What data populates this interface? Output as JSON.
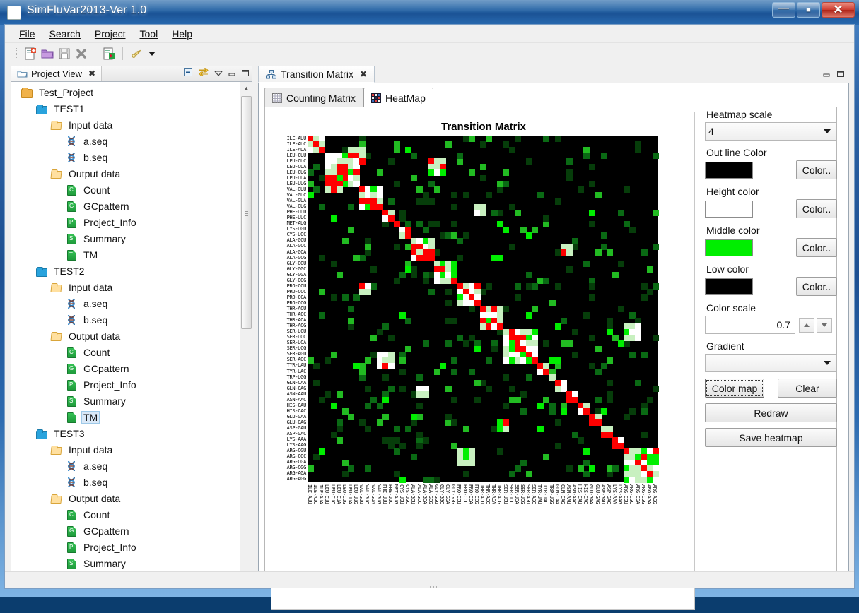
{
  "window": {
    "title": "SimFluVar2013-Ver 1.0",
    "app_icon": "app-icon",
    "buttons": {
      "minimize": "—",
      "maximize": "❐",
      "close": "✕"
    }
  },
  "menubar": {
    "items": [
      "File",
      "Search",
      "Project",
      "Tool",
      "Help"
    ]
  },
  "toolbar": {
    "icons": [
      "new-file-icon",
      "open-folder-icon",
      "save-icon",
      "delete-icon",
      "export-icon",
      "run-icon"
    ],
    "dropdown": "chevron-down-icon"
  },
  "project_view": {
    "tab_label": "Project View",
    "close": "✖",
    "tools": [
      "collapse-all-icon",
      "link-with-editor-icon",
      "view-menu-icon",
      "minimize-icon",
      "maximize-icon"
    ],
    "tree": [
      {
        "label": "Test_Project",
        "depth": 0,
        "icon": "project-folder-icon",
        "selected": false
      },
      {
        "label": "TEST1",
        "depth": 1,
        "icon": "blue-folder-icon",
        "selected": false
      },
      {
        "label": "Input data",
        "depth": 2,
        "icon": "open-folder-icon",
        "selected": false
      },
      {
        "label": "a.seq",
        "depth": 3,
        "icon": "dna-icon",
        "selected": false
      },
      {
        "label": "b.seq",
        "depth": 3,
        "icon": "dna-icon",
        "selected": false
      },
      {
        "label": "Output data",
        "depth": 2,
        "icon": "open-folder-icon",
        "selected": false
      },
      {
        "label": "Count",
        "depth": 3,
        "icon": "doc-c-icon",
        "selected": false,
        "ch": "C"
      },
      {
        "label": "GCpattern",
        "depth": 3,
        "icon": "doc-g-icon",
        "selected": false,
        "ch": "G"
      },
      {
        "label": "Project_Info",
        "depth": 3,
        "icon": "doc-p-icon",
        "selected": false,
        "ch": "P"
      },
      {
        "label": "Summary",
        "depth": 3,
        "icon": "doc-s-icon",
        "selected": false,
        "ch": "S"
      },
      {
        "label": "TM",
        "depth": 3,
        "icon": "doc-t-icon",
        "selected": false,
        "ch": "T"
      },
      {
        "label": "TEST2",
        "depth": 1,
        "icon": "blue-folder-icon",
        "selected": false
      },
      {
        "label": "Input data",
        "depth": 2,
        "icon": "open-folder-icon",
        "selected": false
      },
      {
        "label": "a.seq",
        "depth": 3,
        "icon": "dna-icon",
        "selected": false
      },
      {
        "label": "b.seq",
        "depth": 3,
        "icon": "dna-icon",
        "selected": false
      },
      {
        "label": "Output data",
        "depth": 2,
        "icon": "open-folder-icon",
        "selected": false
      },
      {
        "label": "Count",
        "depth": 3,
        "icon": "doc-c-icon",
        "selected": false,
        "ch": "C"
      },
      {
        "label": "GCpattern",
        "depth": 3,
        "icon": "doc-g-icon",
        "selected": false,
        "ch": "G"
      },
      {
        "label": "Project_Info",
        "depth": 3,
        "icon": "doc-p-icon",
        "selected": false,
        "ch": "P"
      },
      {
        "label": "Summary",
        "depth": 3,
        "icon": "doc-s-icon",
        "selected": false,
        "ch": "S"
      },
      {
        "label": "TM",
        "depth": 3,
        "icon": "doc-t-icon",
        "selected": true,
        "ch": "T"
      },
      {
        "label": "TEST3",
        "depth": 1,
        "icon": "blue-folder-icon",
        "selected": false
      },
      {
        "label": "Input data",
        "depth": 2,
        "icon": "open-folder-icon",
        "selected": false
      },
      {
        "label": "a.seq",
        "depth": 3,
        "icon": "dna-icon",
        "selected": false
      },
      {
        "label": "b.seq",
        "depth": 3,
        "icon": "dna-icon",
        "selected": false
      },
      {
        "label": "Output data",
        "depth": 2,
        "icon": "open-folder-icon",
        "selected": false
      },
      {
        "label": "Count",
        "depth": 3,
        "icon": "doc-c-icon",
        "selected": false,
        "ch": "C"
      },
      {
        "label": "GCpattern",
        "depth": 3,
        "icon": "doc-g-icon",
        "selected": false,
        "ch": "G"
      },
      {
        "label": "Project_Info",
        "depth": 3,
        "icon": "doc-p-icon",
        "selected": false,
        "ch": "P"
      },
      {
        "label": "Summary",
        "depth": 3,
        "icon": "doc-s-icon",
        "selected": false,
        "ch": "S"
      }
    ]
  },
  "editor": {
    "tab_label": "Transition Matrix",
    "tab_icon": "matrix-icon",
    "close": "✖",
    "tools": [
      "minimize-icon",
      "maximize-icon"
    ],
    "inner_tabs": [
      {
        "label": "Counting Matrix",
        "icon": "grid-icon",
        "active": false
      },
      {
        "label": "HeatMap",
        "icon": "heatmap-icon",
        "active": true
      }
    ]
  },
  "controls": {
    "heatmap_scale": {
      "label": "Heatmap scale",
      "value": "4"
    },
    "outline_color": {
      "label": "Out line Color",
      "color": "#000000",
      "button": "Color.."
    },
    "height_color": {
      "label": "Height color",
      "color": "#ffffff",
      "button": "Color.."
    },
    "middle_color": {
      "label": "Middle color",
      "color": "#00ee00",
      "button": "Color.."
    },
    "low_color": {
      "label": "Low color",
      "color": "#000000",
      "button": "Color.."
    },
    "color_scale": {
      "label": "Color scale",
      "value": "0.7"
    },
    "gradient": {
      "label": "Gradient",
      "value": ""
    },
    "color_map_button": "Color map",
    "clear_button": "Clear",
    "redraw_button": "Redraw",
    "save_heatmap_button": "Save heatmap"
  },
  "chart_data": {
    "type": "heatmap",
    "title": "Transition Matrix",
    "xlabel": "",
    "ylabel": "",
    "grid": false,
    "legend": "none",
    "colorscale": {
      "low": "#000000",
      "middle": "#00ee00",
      "high": "#ffffff",
      "special": "#ff0000"
    },
    "categories": [
      "ILE-AUU",
      "ILE-AUC",
      "ILE-AUA",
      "LEU-CUU",
      "LEU-CUC",
      "LEU-CUA",
      "LEU-CUG",
      "LEU-UUA",
      "LEU-UUG",
      "VAL-GUU",
      "VAL-GUC",
      "VAL-GUA",
      "VAL-GUG",
      "PHE-UUU",
      "PHE-UUC",
      "MET-AUG",
      "CYS-UGU",
      "CYS-UGC",
      "ALA-GCU",
      "ALA-GCC",
      "ALA-GCA",
      "ALA-GCG",
      "GLY-GGU",
      "GLY-GGC",
      "GLY-GGA",
      "GLY-GGG",
      "PRO-CCU",
      "PRO-CCC",
      "PRO-CCA",
      "PRO-CCG",
      "THR-ACU",
      "THR-ACC",
      "THR-ACA",
      "THR-ACG",
      "SER-UCU",
      "SER-UCC",
      "SER-UCA",
      "SER-UCG",
      "SER-AGU",
      "SER-AGC",
      "TYR-UAU",
      "TYR-UAC",
      "TRP-UGG",
      "GLN-CAA",
      "GLN-CAG",
      "ASN-AAU",
      "ASN-AAC",
      "HIS-CAU",
      "HIS-CAC",
      "GLU-GAA",
      "GLU-GAG",
      "ASP-GAU",
      "ASP-GAC",
      "LYS-AAA",
      "LYS-AAG",
      "ARG-CGU",
      "ARG-CGC",
      "ARG-CGA",
      "ARG-CGG",
      "ARG-AGA",
      "ARG-AGG"
    ],
    "n": 61,
    "description": "61x61 codon transition matrix. Bright diagonal blocks group synonymous codons of the same amino acid; red marks high values, white mid-high, bright green mid, dark green low, black zero."
  }
}
